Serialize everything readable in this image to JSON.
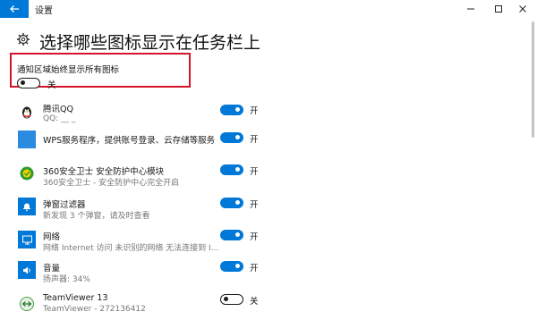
{
  "window": {
    "title": "设置"
  },
  "page": {
    "title": "选择哪些图标显示在任务栏上"
  },
  "always_show": {
    "label": "通知区域始终显示所有图标",
    "state_text": "关",
    "on": false
  },
  "apps": [
    {
      "icon": "qq-penguin-icon",
      "name": "腾讯QQ",
      "description": "QQ: __ _",
      "state_text": "开",
      "on": true
    },
    {
      "icon": "wps-service-icon",
      "name": "WPS服务程序，提供账号登录、云存储等服务",
      "description": "",
      "state_text": "开",
      "on": true
    },
    {
      "icon": "shield-360-icon",
      "name": "360安全卫士 安全防护中心模块",
      "description": "360安全卫士 - 安全防护中心完全开启",
      "state_text": "开",
      "on": true
    },
    {
      "icon": "popup-filter-bell-icon",
      "name": "弹窗过滤器",
      "description": "新发现 3 个弹窗，请及时查看",
      "state_text": "开",
      "on": true
    },
    {
      "icon": "network-icon",
      "name": "网络",
      "description": "网络 Internet 访问  未识别的网络 无法连接到 I...",
      "state_text": "开",
      "on": true
    },
    {
      "icon": "volume-icon",
      "name": "音量",
      "description": "扬声器: 34%",
      "state_text": "开",
      "on": true
    },
    {
      "icon": "teamviewer-icon",
      "name": "TeamViewer 13",
      "description": "TeamViewer - 272136412",
      "state_text": "关",
      "on": false
    }
  ],
  "colors": {
    "accent": "#0078d7",
    "highlight": "#d5142a"
  }
}
